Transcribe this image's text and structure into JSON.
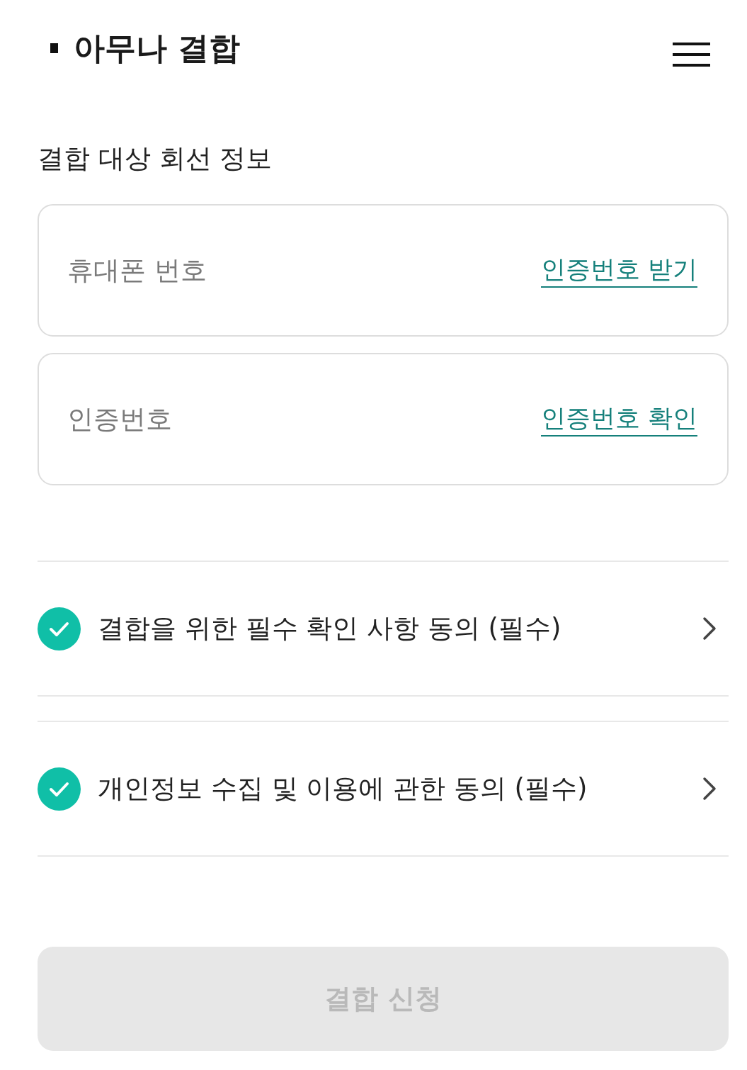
{
  "header": {
    "title": "아무나 결합"
  },
  "section": {
    "title": "결합 대상 회선 정보"
  },
  "fields": [
    {
      "placeholder": "휴대폰 번호",
      "action": "인증번호 받기"
    },
    {
      "placeholder": "인증번호",
      "action": "인증번호 확인"
    }
  ],
  "agreements": [
    {
      "label": "결합을 위한 필수 확인 사항 동의 (필수)",
      "checked": true
    },
    {
      "label": "개인정보 수집 및 이용에 관한 동의 (필수)",
      "checked": true
    }
  ],
  "submit_button": {
    "label": "결합 신청",
    "disabled": true
  }
}
